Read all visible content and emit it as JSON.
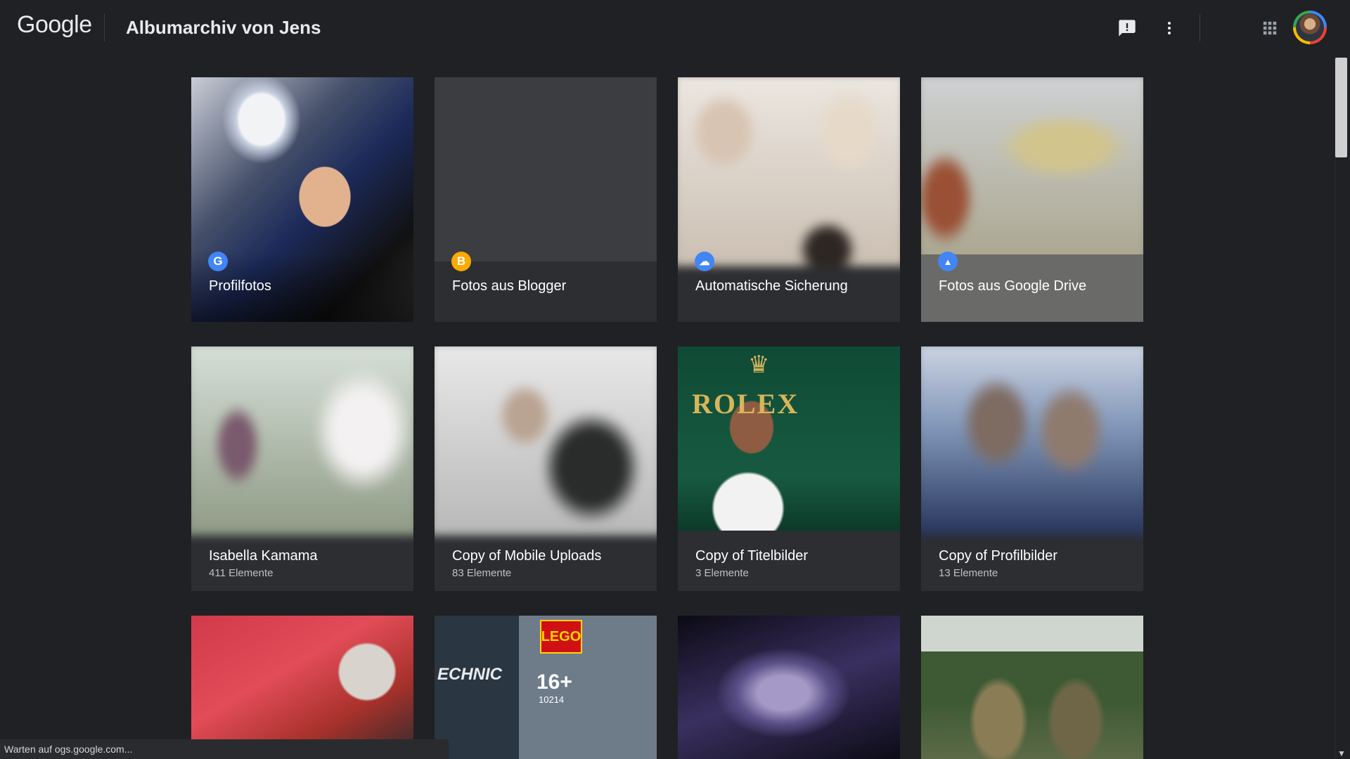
{
  "header": {
    "logo_text": "Google",
    "title": "Albumarchiv von Jens",
    "feedback_icon": "feedback-icon",
    "more_icon": "more-vert-icon",
    "apps_icon": "apps-grid-icon",
    "avatar_icon": "user-avatar"
  },
  "albums": [
    {
      "name": "Profilfotos",
      "count": "",
      "source_icon": "google-g-icon",
      "source_glyph": "G",
      "icon_color": "#4285f4"
    },
    {
      "name": "Fotos aus Blogger",
      "count": "",
      "source_icon": "blogger-icon",
      "source_glyph": "B",
      "icon_color": "#f9ab00"
    },
    {
      "name": "Automatische Sicherung",
      "count": "",
      "source_icon": "cloud-upload-icon",
      "source_glyph": "☁",
      "icon_color": "#4285f4"
    },
    {
      "name": "Fotos aus Google Drive",
      "count": "",
      "source_icon": "google-drive-icon",
      "source_glyph": "▲",
      "icon_color": "#4285f4"
    },
    {
      "name": "Isabella Kamama",
      "count": "411 Elemente"
    },
    {
      "name": "Copy of Mobile Uploads",
      "count": "83 Elemente"
    },
    {
      "name": "Copy of Titelbilder",
      "count": "3 Elemente"
    },
    {
      "name": "Copy of Profilbilder",
      "count": "13 Elemente"
    },
    {
      "name": "",
      "count": ""
    },
    {
      "name": "",
      "count": ""
    },
    {
      "name": "",
      "count": ""
    },
    {
      "name": "",
      "count": ""
    }
  ],
  "thumb_text": {
    "rolex": "ROLEX",
    "crown": "♛",
    "lego": "LEGO",
    "age": "16+",
    "set_number": "10214",
    "technic": "ECHNIC"
  },
  "status_bar": {
    "text": "Warten auf ogs.google.com..."
  }
}
